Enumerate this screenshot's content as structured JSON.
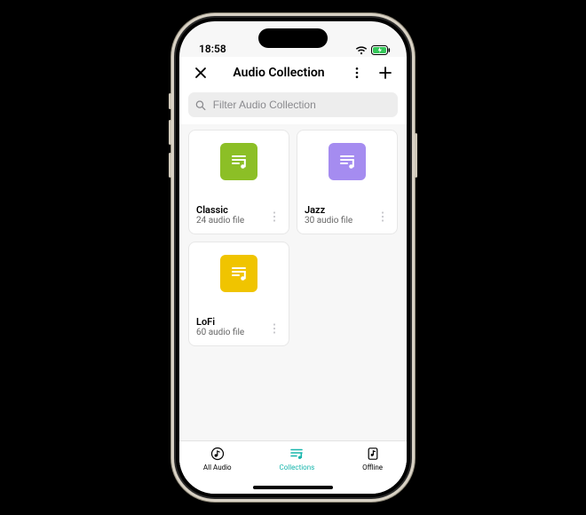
{
  "status": {
    "time": "18:58"
  },
  "header": {
    "title": "Audio Collection"
  },
  "search": {
    "placeholder": "Filter Audio Collection"
  },
  "collections": [
    {
      "name": "Classic",
      "subtitle": "24 audio file",
      "color": "#8cbf26"
    },
    {
      "name": "Jazz",
      "subtitle": "30 audio file",
      "color": "#a58cf0"
    },
    {
      "name": "LoFi",
      "subtitle": "60 audio file",
      "color": "#f0c400"
    }
  ],
  "tabs": [
    {
      "label": "All Audio"
    },
    {
      "label": "Collections"
    },
    {
      "label": "Offline"
    }
  ],
  "active_tab_index": 1
}
